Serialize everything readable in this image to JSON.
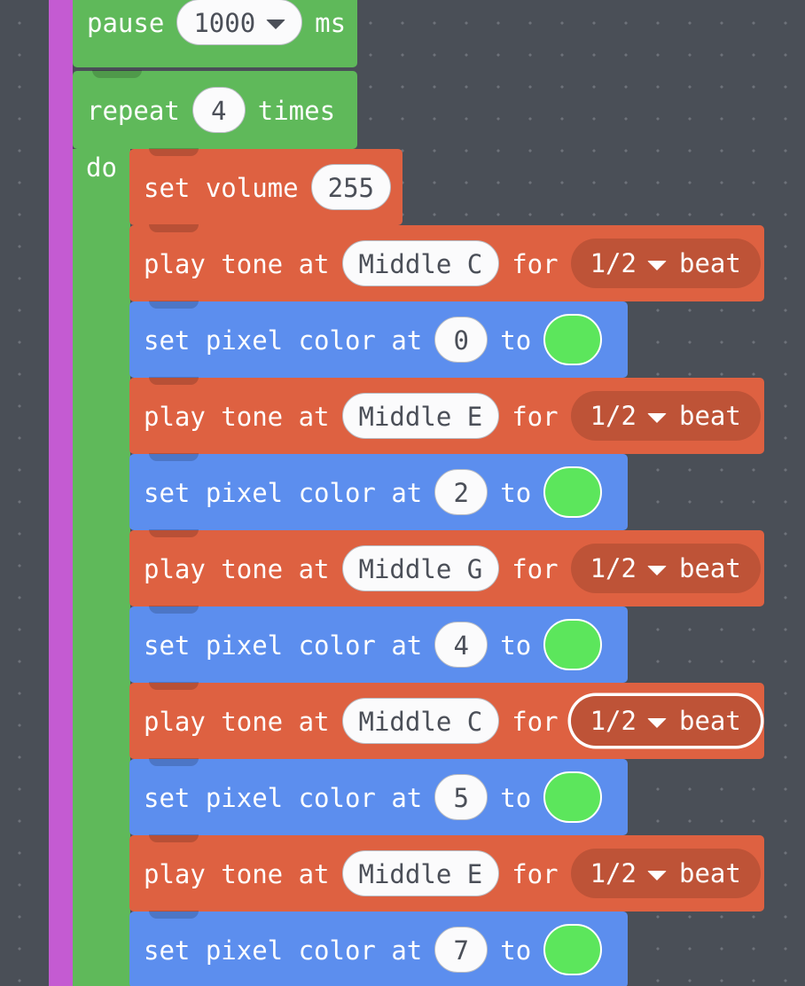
{
  "app": {
    "name": "makecode-blocks-editor",
    "canvas_background": "#4a4f57",
    "grid_dot_color": "#6d727a"
  },
  "colors": {
    "event_spine": "#c45bd2",
    "loops_green": "#5fb95a",
    "music_orange": "#de6141",
    "light_blue": "#5c8eee",
    "pixel_green": "#5ce65c",
    "field_white": "#fbfbfc",
    "field_text": "#4b4f58"
  },
  "blocks": {
    "pause": {
      "label": "pause",
      "value": "1000",
      "unit": "ms",
      "category": "loops-green"
    },
    "repeat": {
      "label": "repeat",
      "value": "4",
      "suffix": "times",
      "do_label": "do",
      "category": "loops-green"
    },
    "set_volume": {
      "label": "set volume",
      "value": "255",
      "category": "music-orange"
    },
    "body": [
      {
        "kind": "play-tone",
        "label": "play tone at",
        "note": "Middle C",
        "for_label": "for",
        "duration": "1/2",
        "beat_label": "beat",
        "focused": false
      },
      {
        "kind": "set-pixel-color",
        "label": "set pixel color at",
        "index": "0",
        "to_label": "to",
        "color": "#5ce65c"
      },
      {
        "kind": "play-tone",
        "label": "play tone at",
        "note": "Middle E",
        "for_label": "for",
        "duration": "1/2",
        "beat_label": "beat",
        "focused": false
      },
      {
        "kind": "set-pixel-color",
        "label": "set pixel color at",
        "index": "2",
        "to_label": "to",
        "color": "#5ce65c"
      },
      {
        "kind": "play-tone",
        "label": "play tone at",
        "note": "Middle G",
        "for_label": "for",
        "duration": "1/2",
        "beat_label": "beat",
        "focused": false
      },
      {
        "kind": "set-pixel-color",
        "label": "set pixel color at",
        "index": "4",
        "to_label": "to",
        "color": "#5ce65c"
      },
      {
        "kind": "play-tone",
        "label": "play tone at",
        "note": "Middle C",
        "for_label": "for",
        "duration": "1/2",
        "beat_label": "beat",
        "focused": true
      },
      {
        "kind": "set-pixel-color",
        "label": "set pixel color at",
        "index": "5",
        "to_label": "to",
        "color": "#5ce65c"
      },
      {
        "kind": "play-tone",
        "label": "play tone at",
        "note": "Middle E",
        "for_label": "for",
        "duration": "1/2",
        "beat_label": "beat",
        "focused": false
      },
      {
        "kind": "set-pixel-color",
        "label": "set pixel color at",
        "index": "7",
        "to_label": "to",
        "color": "#5ce65c"
      }
    ]
  }
}
